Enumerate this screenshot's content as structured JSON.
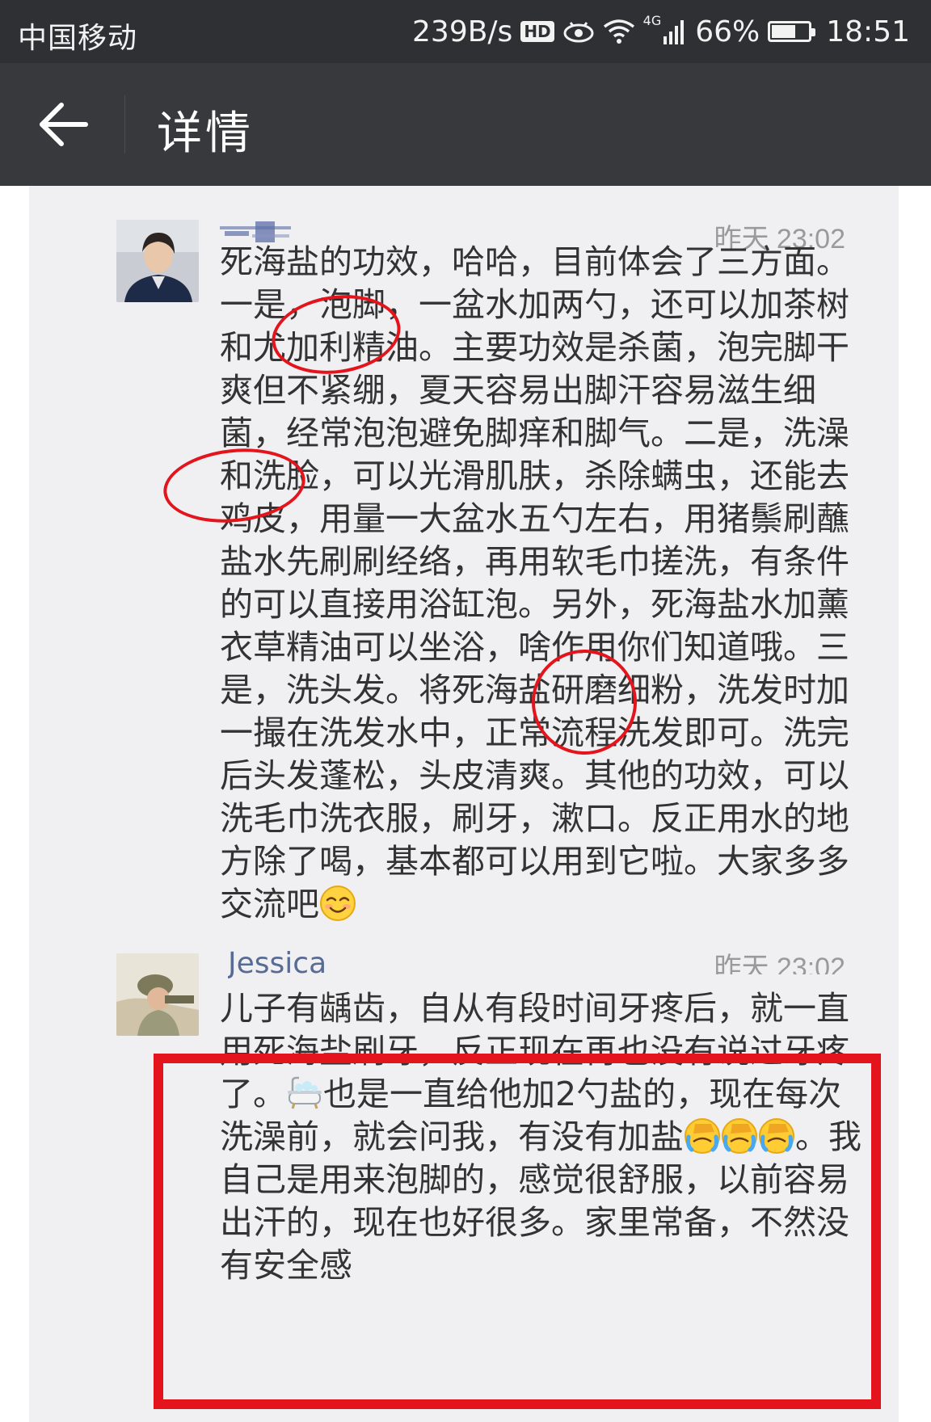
{
  "status_bar": {
    "carrier": "中国移动",
    "speed": "239B/s",
    "hd": "HD",
    "network": "4G",
    "battery": "66%",
    "time": "18:51"
  },
  "title_bar": {
    "title": "详情"
  },
  "comments": [
    {
      "author": "",
      "time": "昨天 23:02",
      "text": "死海盐的功效，哈哈，目前体会了三方面。一是，泡脚，一盆水加两勺，还可以加茶树和尤加利精油。主要功效是杀菌，泡完脚干爽但不紧绷，夏天容易出脚汗容易滋生细菌，经常泡泡避免脚痒和脚气。二是，洗澡和洗脸，可以光滑肌肤，杀除螨虫，还能去鸡皮，用量一大盆水五勺左右，用猪鬃刷蘸盐水先刷刷经络，再用软毛巾搓洗，有条件的可以直接用浴缸泡。另外，死海盐水加薰衣草精油可以坐浴，啥作用你们知道哦。三是，洗头发。将死海盐研磨细粉，洗发时加一撮在洗发水中，正常流程洗发即可。洗完后头发蓬松，头皮清爽。其他的功效，可以洗毛巾洗衣服，刷牙，漱口。反正用水的地方除了喝，基本都可以用到它啦。大家多多交流吧",
      "emoji": "smile-emoji"
    },
    {
      "author": "Jessica",
      "time": "昨天 23:02",
      "text_a": "儿子有龋齿，自从有段时间牙疼后，就一直用死海盐刷牙，反正现在再也没有说过牙疼了。",
      "text_b": "也是一直给他加2勺盐的，现在每次洗澡前，就会问我，有没有加盐",
      "text_c": "。我自己是用来泡脚的，感觉很舒服，以前容易出汗的，现在也好很多。家里常备，不然没有安全感"
    }
  ],
  "colors": {
    "status_bar": "#2f3033",
    "title_bar": "#38393d",
    "content_bg": "#f0f0f2",
    "annotation_red": "#e3141c",
    "author_blue": "#576b95"
  }
}
